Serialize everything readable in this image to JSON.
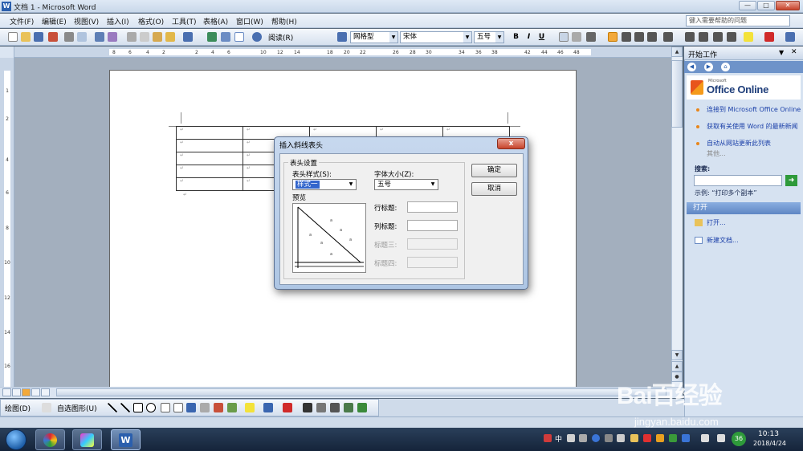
{
  "window": {
    "title": "文档 1 - Microsoft Word",
    "min": "—",
    "max": "□",
    "close": "✕"
  },
  "menu": [
    "文件(F)",
    "编辑(E)",
    "视图(V)",
    "插入(I)",
    "格式(O)",
    "工具(T)",
    "表格(A)",
    "窗口(W)",
    "帮助(H)"
  ],
  "help_placeholder": "键入需要帮助的问题",
  "toolbar": {
    "read_label": "阅读(R)",
    "style_combo": "网格型",
    "font_combo": "宋体",
    "size_combo": "五号",
    "bold": "B",
    "italic": "I",
    "underline": "U"
  },
  "ruler": {
    "h_numbers": [
      "8",
      "6",
      "4",
      "2",
      "2",
      "4",
      "6",
      "10",
      "12",
      "14",
      "18",
      "20",
      "22",
      "26",
      "28",
      "30",
      "34",
      "36",
      "38",
      "42",
      "44",
      "46",
      "48"
    ],
    "v_numbers": [
      "1",
      "2",
      "4",
      "6",
      "8",
      "10",
      "12",
      "14",
      "16",
      "18",
      "20"
    ]
  },
  "doc_table": {
    "rows": 5,
    "cols": 5,
    "cell_mark": "↵"
  },
  "dialog": {
    "title": "插入斜线表头",
    "close": "x",
    "group_label": "表头设置",
    "style_label": "表头样式(S):",
    "style_value": "样式一",
    "size_label": "字体大小(Z):",
    "size_value": "五号",
    "preview_label": "预览",
    "row_title_label": "行标题:",
    "col_title_label": "列标题:",
    "title3_label": "标题三:",
    "title4_label": "标题四:",
    "ok": "确定",
    "cancel": "取消"
  },
  "taskpane": {
    "header": "开始工作",
    "office_ms": "Microsoft",
    "office_online": "Office Online",
    "links": [
      "连接到 Microsoft Office Online",
      "获取有关使用 Word 的最新新闻",
      "自动从网站更新此列表"
    ],
    "more": "其他...",
    "search_label": "搜索:",
    "example": "示例: “打印多个副本”",
    "open_header": "打开",
    "open_items": [
      "打开...",
      "新建文档..."
    ]
  },
  "drawbar": {
    "draw": "绘图(D)",
    "autoshapes": "自选图形(U)"
  },
  "taskbar": {
    "time": "10:13",
    "date": "2018/4/24",
    "badge": "36",
    "ime": "中"
  },
  "watermark": {
    "main": "Bai百经验",
    "sub": "jingyan.baidu.com"
  }
}
